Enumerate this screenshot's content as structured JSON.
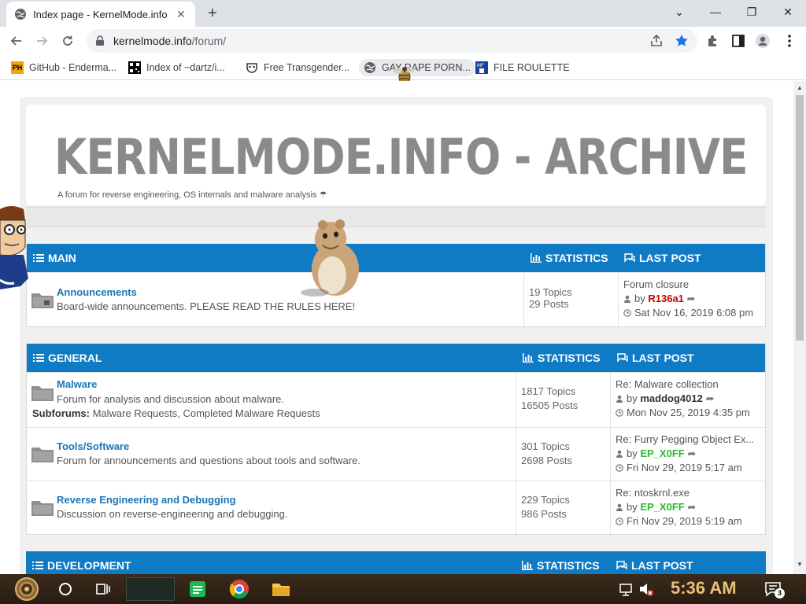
{
  "browser": {
    "tab_title": "Index page - KernelMode.info",
    "tab_close": "✕",
    "new_tab": "+",
    "win_minimize": "⌄",
    "win_min": "—",
    "win_restore": "❐",
    "win_close": "✕",
    "url_host": "kernelmode.info",
    "url_path": "/forum/",
    "bookmarks": [
      {
        "label": "GitHub - Enderma...",
        "icon": "ph-icon",
        "color": "#f2a30f"
      },
      {
        "label": "Index of ~dartz/i...",
        "icon": "qr-icon",
        "color": "#000000"
      },
      {
        "label": "Free Transgender...",
        "icon": "mask-icon",
        "color": "#333333"
      },
      {
        "label": "GAY RAPE PORN...",
        "icon": "globe-icon",
        "color": "#5f6368"
      },
      {
        "label": "FILE ROULETTE",
        "icon": "file-roulette-icon",
        "color": "#1a3f9c"
      }
    ]
  },
  "forum": {
    "site_title": "KERNELMODE.INFO - ARCHIVE",
    "site_desc": "A forum for reverse engineering, OS internals and malware analysis ☂",
    "sections": [
      {
        "name": "MAIN",
        "stats_label": "STATISTICS",
        "last_label": "LAST POST",
        "forums": [
          {
            "title": "Announcements",
            "desc": "Board-wide announcements. PLEASE READ THE RULES HERE!",
            "topics": "19 Topics",
            "posts": "29 Posts",
            "last_title": "Forum closure",
            "by": "by",
            "last_user": "R136a1",
            "last_user_color": "#cc0000",
            "last_date": "Sat Nov 16, 2019 6:08 pm"
          }
        ]
      },
      {
        "name": "GENERAL",
        "stats_label": "STATISTICS",
        "last_label": "LAST POST",
        "forums": [
          {
            "title": "Malware",
            "desc": "Forum for analysis and discussion about malware.",
            "subforums_label": "Subforums:",
            "subforums": "Malware Requests, Completed Malware Requests",
            "topics": "1817 Topics",
            "posts": "16505 Posts",
            "last_title": "Re: Malware collection",
            "by": "by",
            "last_user": "maddog4012",
            "last_user_color": "#333333",
            "last_date": "Mon Nov 25, 2019 4:35 pm"
          },
          {
            "title": "Tools/Software",
            "desc": "Forum for announcements and questions about tools and software.",
            "topics": "301 Topics",
            "posts": "2698 Posts",
            "last_title": "Re: Furry Pegging Object Ex...",
            "by": "by",
            "last_user": "EP_X0FF",
            "last_user_color": "#2eb82e",
            "last_date": "Fri Nov 29, 2019 5:17 am"
          },
          {
            "title": "Reverse Engineering and Debugging",
            "desc": "Discussion on reverse-engineering and debugging.",
            "topics": "229 Topics",
            "posts": "986 Posts",
            "last_title": "Re: ntoskrnl.exe",
            "by": "by",
            "last_user": "EP_X0FF",
            "last_user_color": "#2eb82e",
            "last_date": "Fri Nov 29, 2019 5:19 am"
          }
        ]
      },
      {
        "name": "DEVELOPMENT",
        "stats_label": "STATISTICS",
        "last_label": "LAST POST",
        "forums": []
      }
    ]
  },
  "taskbar": {
    "clock": "5:36 AM",
    "notification_count": "3"
  },
  "colors": {
    "section_header": "#0f7bc4",
    "forum_link": "#1a75b5"
  }
}
